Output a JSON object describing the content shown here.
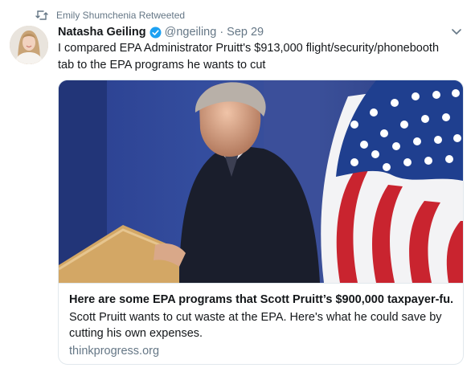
{
  "retweet": {
    "label": "Emily Shumchenia Retweeted",
    "icon": "retweet-icon"
  },
  "author": {
    "name": "Natasha Geiling",
    "verified": true,
    "handle": "@ngeiling",
    "separator": "·",
    "time": "Sep 29"
  },
  "tweet": {
    "line1": "I compared EPA Administrator Pruitt's $913,000 flight/security/phonebooth",
    "line2": "tab to the EPA programs he wants to cut"
  },
  "card": {
    "title": "Here are some EPA programs that Scott Pruitt’s $900,000 taxpayer-fu...",
    "description": "Scott Pruitt wants to cut waste at the EPA. Here's what he could save by cutting his own expenses.",
    "domain": "thinkprogress.org"
  },
  "colors": {
    "text": "#14171a",
    "muted": "#657786",
    "verified": "#1da1f2",
    "border": "#e1e8ed"
  }
}
